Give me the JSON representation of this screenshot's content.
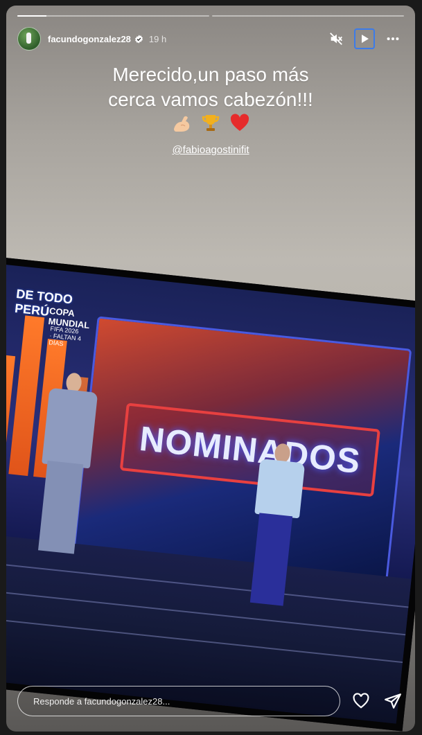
{
  "progress": {
    "segments": 2,
    "active_fraction": 0.15
  },
  "header": {
    "username": "facundogonzalez28",
    "time": "19 h",
    "icons": [
      "mute-icon",
      "play-icon",
      "more-icon"
    ]
  },
  "caption": {
    "line1": "Merecido,un paso más",
    "line2": "cerca vamos cabezón!!!",
    "emojis": [
      "flexed-biceps",
      "trophy",
      "red-heart"
    ]
  },
  "mention": "@fabioagostinifit",
  "tv": {
    "logo_line1": "DE TODO PERÚ",
    "logo_line2": "COPA MUNDIAL",
    "logo_line3": "FIFA 2026 · FALTAN 4 DÍAS",
    "sign": "NOMINADOS"
  },
  "footer": {
    "reply_placeholder": "Responde a facundogonzalez28...",
    "icons": [
      "heart-icon",
      "send-icon"
    ]
  },
  "colors": {
    "focus_outline": "#3b7bea",
    "sign_border": "#e84040"
  }
}
